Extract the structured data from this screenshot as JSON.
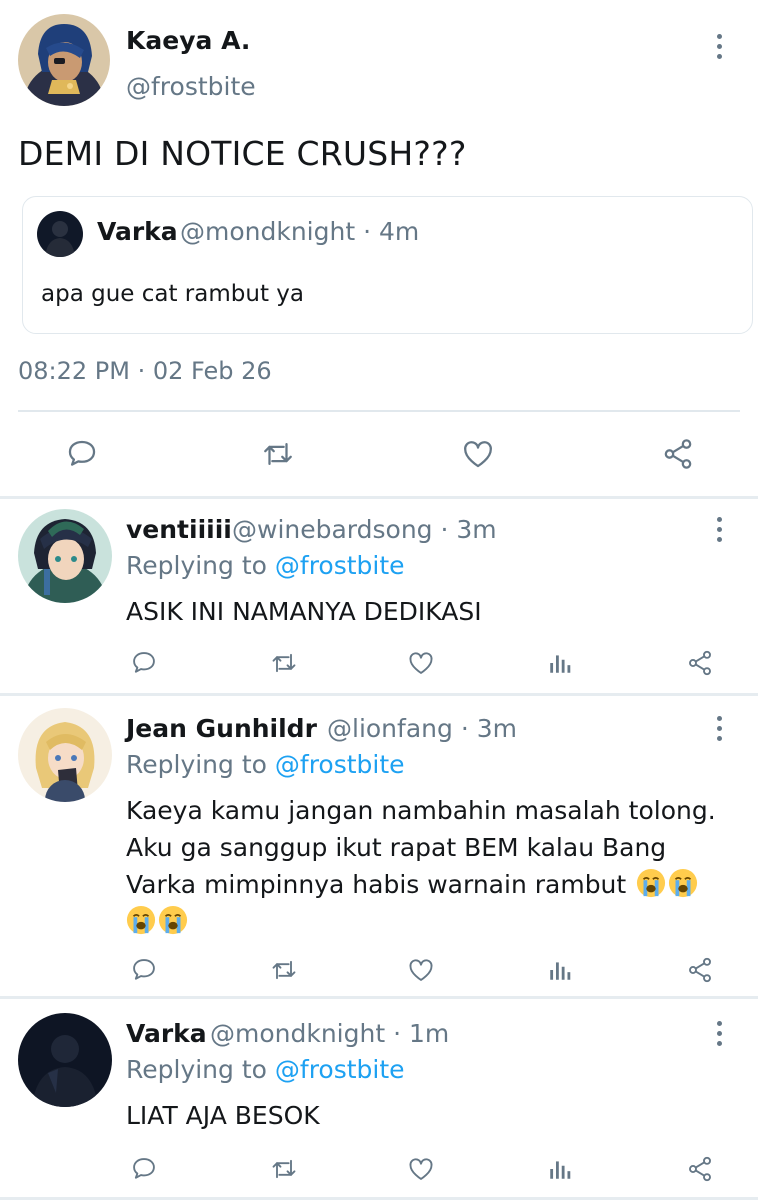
{
  "main_tweet": {
    "author": {
      "name": "Kaeya A.",
      "handle": "@frostbite",
      "avatar": "kaeya-avatar"
    },
    "text": "DEMI DI NOTICE CRUSH???",
    "quoted": {
      "name": "Varka",
      "handle_time": "@mondknight · 4m",
      "text": "apa gue cat rambut ya",
      "avatar": "varka-avatar"
    },
    "timestamp": "08:22 PM · 02 Feb 26",
    "actions": [
      "reply-icon",
      "retweet-icon",
      "like-icon",
      "share-icon"
    ]
  },
  "replies": [
    {
      "name": "ventiiiii",
      "handle_time": "@winebardsong · 3m",
      "replying_prefix": "Replying to ",
      "replying_to": "@frostbite",
      "text": "ASIK INI NAMANYA DEDIKASI",
      "avatar": "venti-avatar"
    },
    {
      "name": "Jean Gunhildr",
      "handle_time": "@lionfang · 3m",
      "replying_prefix": "Replying to ",
      "replying_to": "@frostbite",
      "text_lines": [
        "Kaeya kamu jangan nambahin masalah tolong.",
        "Aku ga sanggup ikut rapat BEM kalau Bang",
        "Varka mimpinnya habis warnain rambut"
      ],
      "emoji": [
        "loudly-crying-face",
        "loudly-crying-face",
        "loudly-crying-face",
        "loudly-crying-face"
      ],
      "avatar": "jean-avatar"
    },
    {
      "name": "Varka",
      "handle_time": "@mondknight · 1m",
      "replying_prefix": "Replying to ",
      "replying_to": "@frostbite",
      "text": "LIAT AJA BESOK",
      "avatar": "varka-avatar"
    }
  ],
  "reply_actions": [
    "reply-icon",
    "retweet-icon",
    "like-icon",
    "analytics-icon",
    "share-icon"
  ],
  "colors": {
    "text": "#14171a",
    "secondary": "#657786",
    "mention": "#1da1f2",
    "divider": "#e1e8ed"
  }
}
